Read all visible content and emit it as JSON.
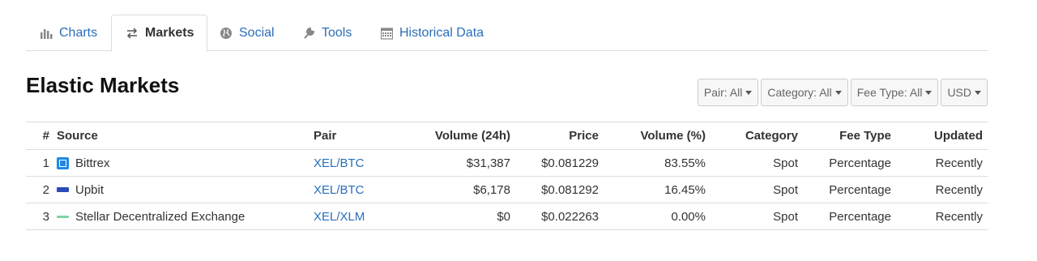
{
  "tabs": [
    {
      "label": "Charts",
      "icon": "bar-chart-icon",
      "active": false
    },
    {
      "label": "Markets",
      "icon": "exchange-arrows-icon",
      "active": true
    },
    {
      "label": "Social",
      "icon": "globe-icon",
      "active": false
    },
    {
      "label": "Tools",
      "icon": "wrench-icon",
      "active": false
    },
    {
      "label": "Historical Data",
      "icon": "calendar-icon",
      "active": false
    }
  ],
  "page_title": "Elastic Markets",
  "filters": {
    "pair": "Pair: All",
    "category": "Category: All",
    "fee_type": "Fee Type: All",
    "currency": "USD"
  },
  "table": {
    "headers": {
      "num": "#",
      "source": "Source",
      "pair": "Pair",
      "volume": "Volume (24h)",
      "price": "Price",
      "volume_pct": "Volume (%)",
      "category": "Category",
      "fee_type": "Fee Type",
      "updated": "Updated"
    },
    "rows": [
      {
        "num": "1",
        "source": "Bittrex",
        "logo": "bittrex-logo-icon",
        "pair": "XEL/BTC",
        "volume": "$31,387",
        "price": "$0.081229",
        "volume_pct": "83.55%",
        "category": "Spot",
        "fee_type": "Percentage",
        "updated": "Recently"
      },
      {
        "num": "2",
        "source": "Upbit",
        "logo": "upbit-logo-icon",
        "pair": "XEL/BTC",
        "volume": "$6,178",
        "price": "$0.081292",
        "volume_pct": "16.45%",
        "category": "Spot",
        "fee_type": "Percentage",
        "updated": "Recently"
      },
      {
        "num": "3",
        "source": "Stellar Decentralized Exchange",
        "logo": "stellar-logo-icon",
        "pair": "XEL/XLM",
        "volume": "$0",
        "price": "$0.022263",
        "volume_pct": "0.00%",
        "category": "Spot",
        "fee_type": "Percentage",
        "updated": "Recently"
      }
    ]
  },
  "colors": {
    "link": "#2a6ebb",
    "border": "#dddddd",
    "filter_bg": "#f7f7f7"
  }
}
